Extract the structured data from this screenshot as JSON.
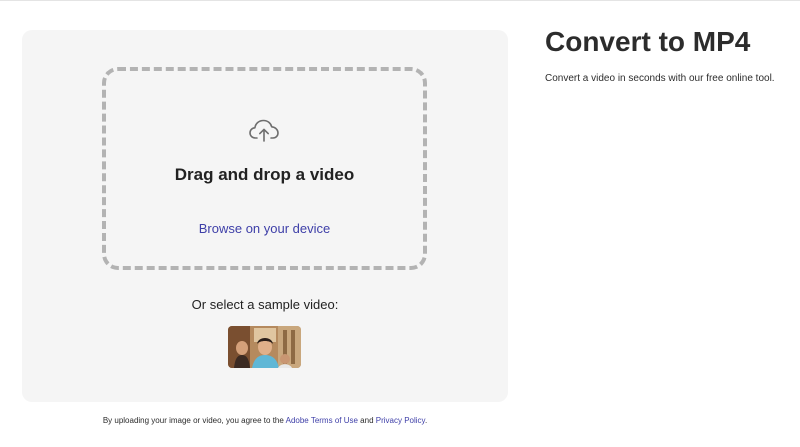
{
  "header": {
    "title": "Convert to MP4",
    "subtitle": "Convert a video in seconds with our free online tool."
  },
  "upload": {
    "icon": "cloud-upload-icon",
    "drop_title": "Drag and drop a video",
    "browse_label": "Browse on your device",
    "sample_label": "Or select a sample video:"
  },
  "footer": {
    "prefix": "By uploading your image or video, you agree to the ",
    "terms_link": "Adobe Terms of Use",
    "middle": " and ",
    "privacy_link": "Privacy Policy",
    "suffix": "."
  },
  "colors": {
    "link": "#3e3fa8",
    "card_bg": "#f5f5f5",
    "dash": "#b3b3b3"
  }
}
